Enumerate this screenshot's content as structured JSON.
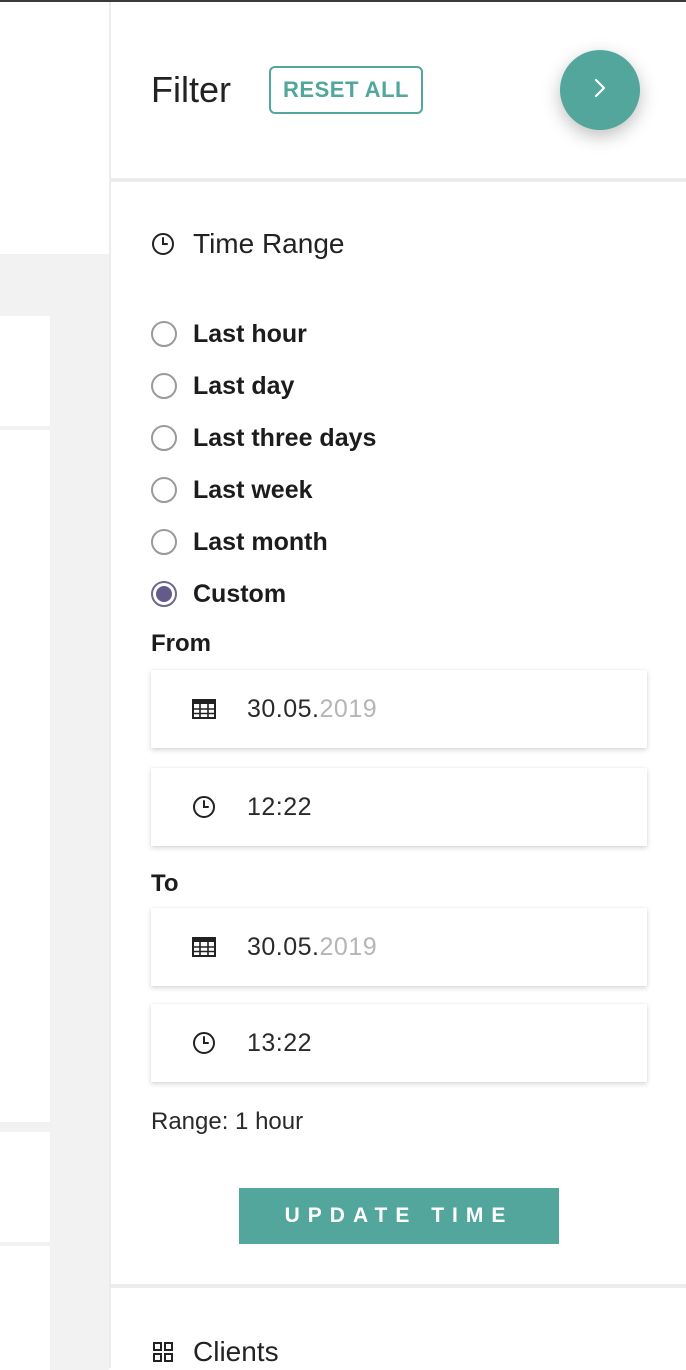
{
  "filter": {
    "title": "Filter",
    "reset_label": "RESET ALL"
  },
  "time_range": {
    "title": "Time Range",
    "options": [
      {
        "label": "Last hour",
        "checked": false
      },
      {
        "label": "Last day",
        "checked": false
      },
      {
        "label": "Last three days",
        "checked": false
      },
      {
        "label": "Last week",
        "checked": false
      },
      {
        "label": "Last month",
        "checked": false
      },
      {
        "label": "Custom",
        "checked": true
      }
    ],
    "from": {
      "label": "From",
      "date_day_month": "30.05.",
      "date_year": "2019",
      "time": "12:22"
    },
    "to": {
      "label": "To",
      "date_day_month": "30.05.",
      "date_year": "2019",
      "time": "13:22"
    },
    "range_text": "Range: 1 hour",
    "update_label": "UPDATE TIME"
  },
  "clients": {
    "title": "Clients"
  },
  "icons": {
    "fab": "chevron-right-icon",
    "time_range": "clock-icon",
    "date": "calendar-icon",
    "time": "clock-icon",
    "clients": "grid-icon"
  },
  "colors": {
    "accent": "#52a69b",
    "radio_checked": "#655a8c",
    "muted_text": "#b5b5b5"
  }
}
